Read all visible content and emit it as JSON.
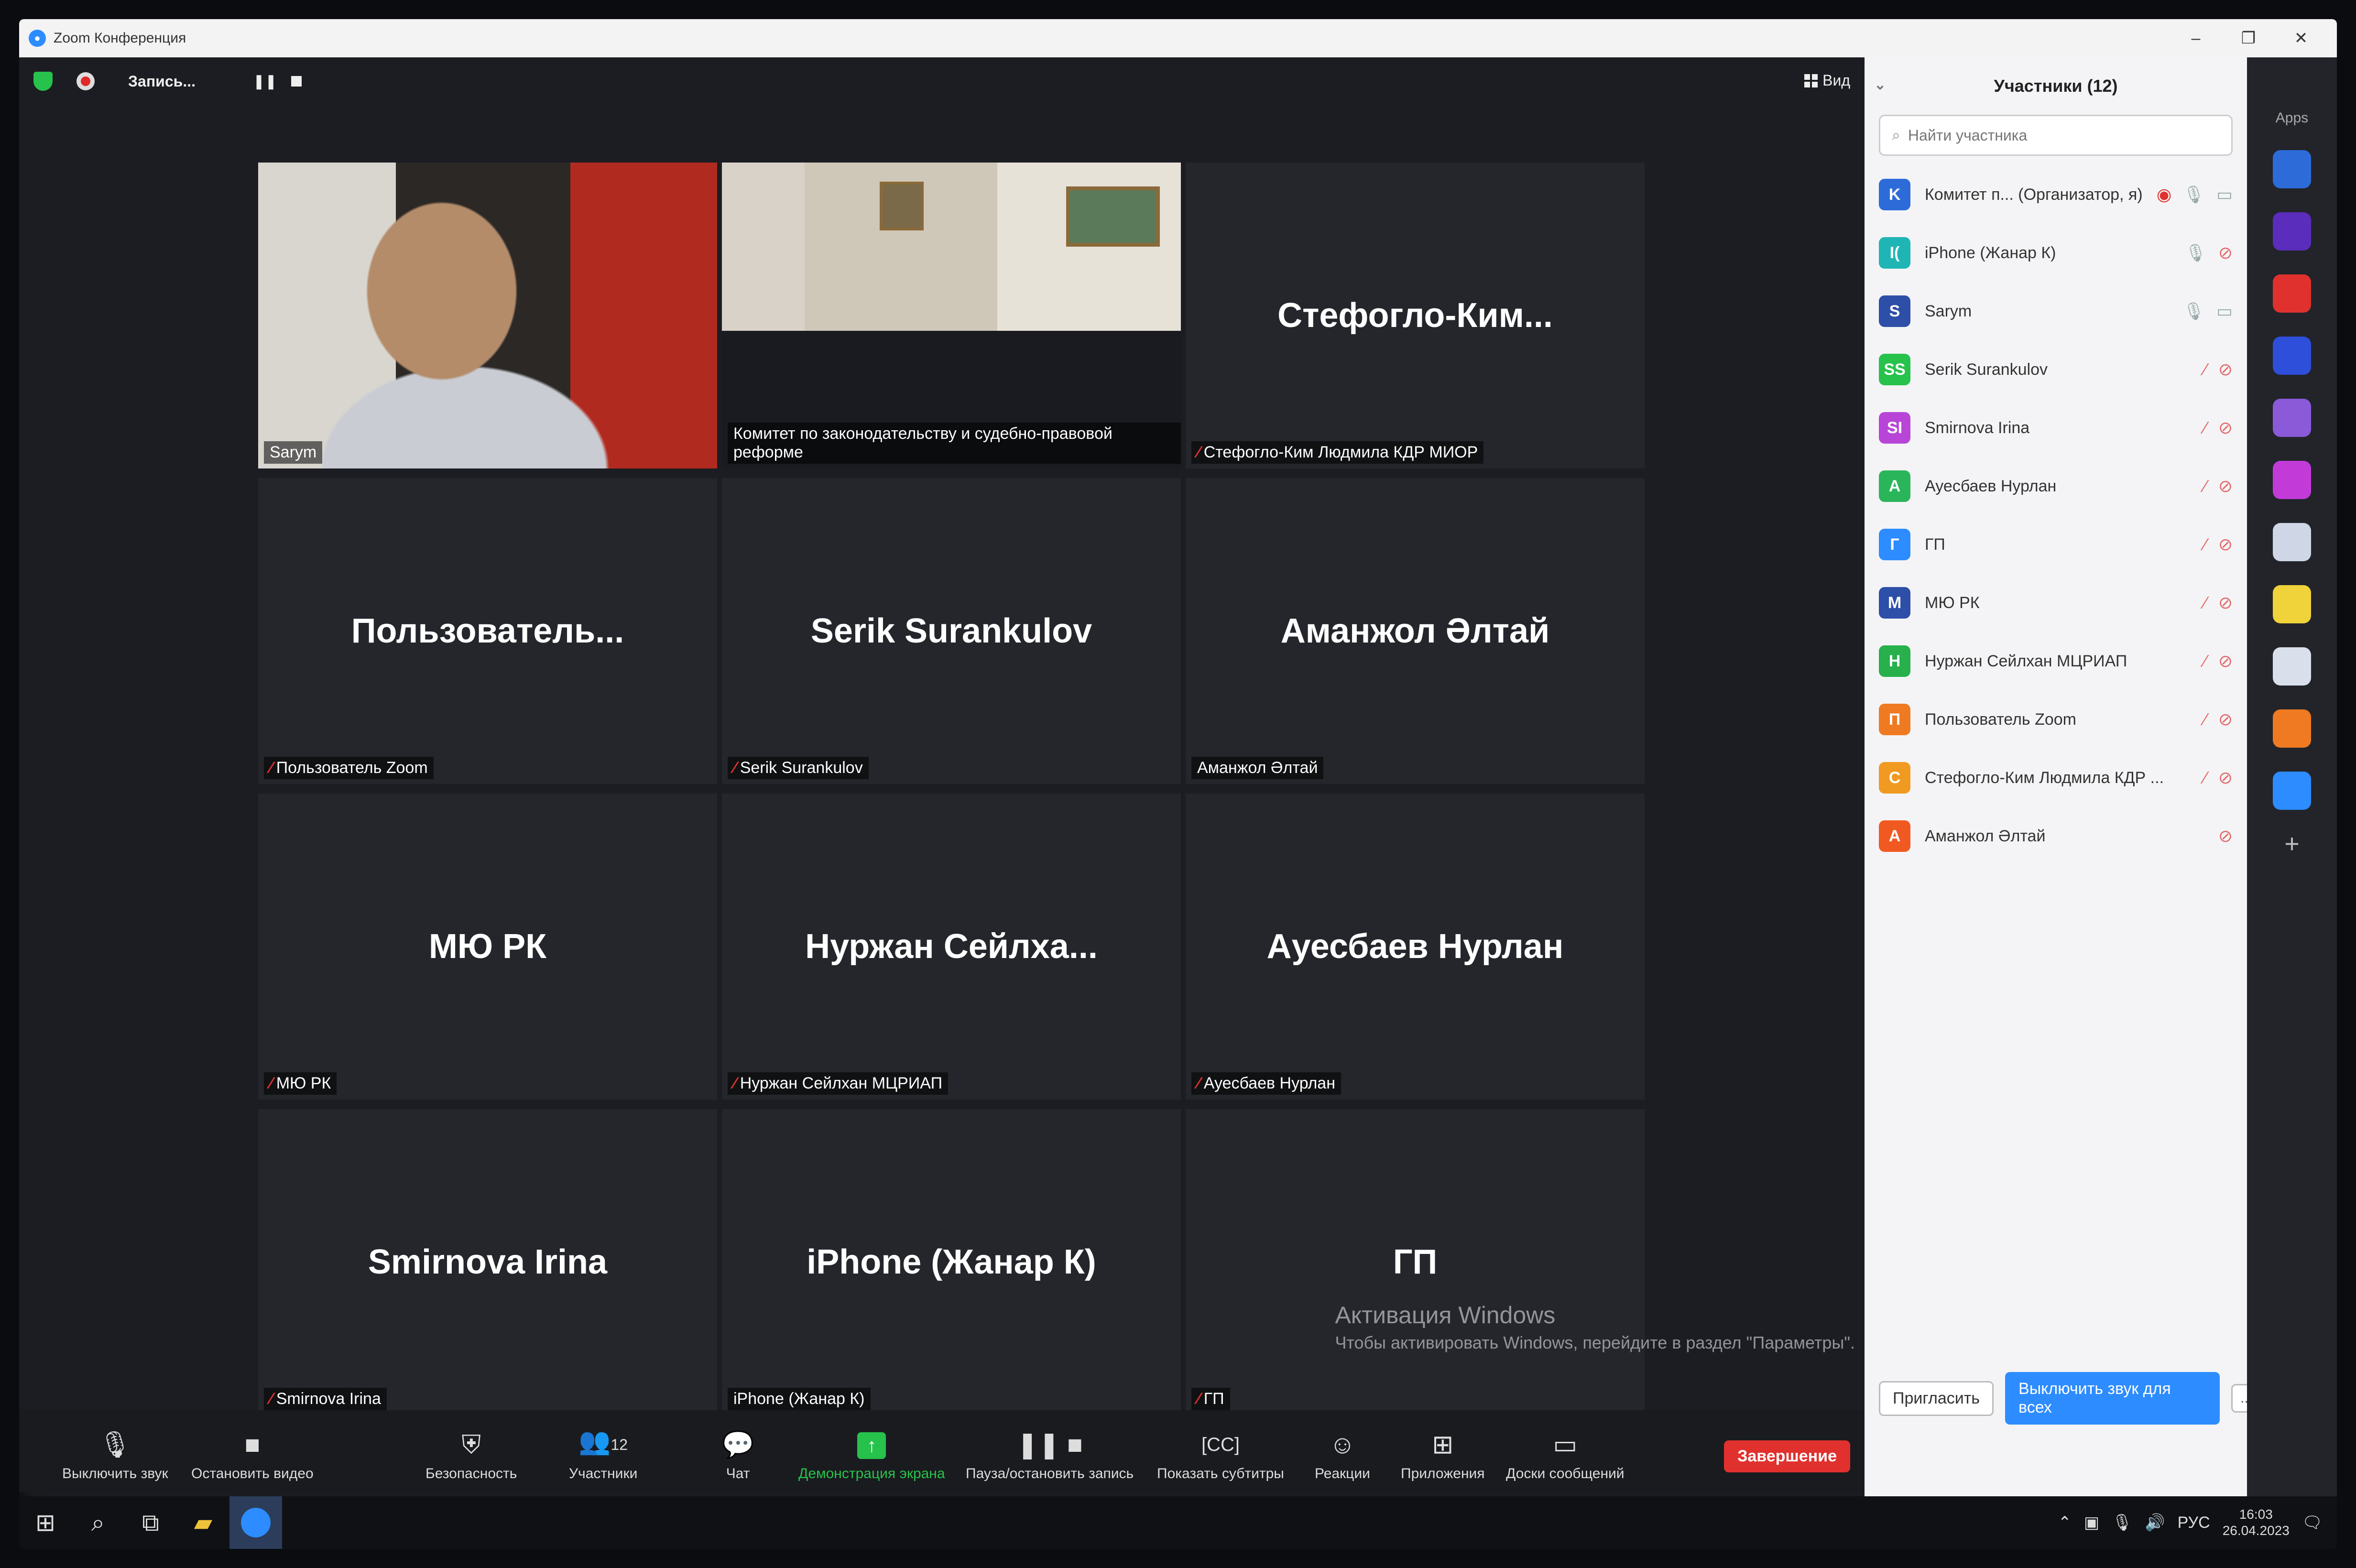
{
  "window": {
    "title": "Zoom Конференция",
    "minimize": "–",
    "restore": "❐",
    "close": "✕"
  },
  "meeting": {
    "recording_label": "Запись...",
    "pause_icon": "❚❚",
    "view_label": "Вид",
    "tiles": [
      {
        "type": "video",
        "caption": "Sarym",
        "muted": false,
        "active": true
      },
      {
        "type": "video",
        "caption": "Комитет по законодательству и судебно-правовой реформе",
        "muted": false,
        "active": false
      },
      {
        "type": "name",
        "display": "Стефогло-Ким...",
        "caption": "Стефогло-Ким Людмила КДР МИОР",
        "muted": true
      },
      {
        "type": "name",
        "display": "Пользователь...",
        "caption": "Пользователь Zoom",
        "muted": true
      },
      {
        "type": "name",
        "display": "Serik Surankulov",
        "caption": "Serik Surankulov",
        "muted": true
      },
      {
        "type": "name",
        "display": "Аманжол Әлтай",
        "caption": "Аманжол Әлтай",
        "muted": false
      },
      {
        "type": "name",
        "display": "МЮ РК",
        "caption": "МЮ РК",
        "muted": true
      },
      {
        "type": "name",
        "display": "Нуржан Сейлха...",
        "caption": "Нуржан Сейлхан МЦРИАП",
        "muted": true
      },
      {
        "type": "name",
        "display": "Ауесбаев Нурлан",
        "caption": "Ауесбаев Нурлан",
        "muted": true
      },
      {
        "type": "name",
        "display": "Smirnova Irina",
        "caption": "Smirnova Irina",
        "muted": true
      },
      {
        "type": "name",
        "display": "iPhone (Жанар К)",
        "caption": "iPhone (Жанар К)",
        "muted": false
      },
      {
        "type": "name",
        "display": "ГП",
        "caption": "ГП",
        "muted": true
      }
    ]
  },
  "toolbar": {
    "mute": "Выключить звук",
    "video": "Остановить видео",
    "security": "Безопасность",
    "participants": "Участники",
    "participants_count": "12",
    "chat": "Чат",
    "share": "Демонстрация экрана",
    "record": "Пауза/остановить запись",
    "captions": "Показать субтитры",
    "reactions": "Реакции",
    "apps": "Приложения",
    "whiteboards": "Доски сообщений",
    "end": "Завершение"
  },
  "watermark": {
    "line1": "Активация Windows",
    "line2": "Чтобы активировать Windows, перейдите в раздел \"Параметры\"."
  },
  "panel": {
    "title": "Участники (12)",
    "search_placeholder": "Найти участника",
    "participants": [
      {
        "initial": "K",
        "name": "Комитет п... (Организатор, я)",
        "color": "#2d6bd9",
        "mic": "on",
        "cam": "on",
        "rec": true
      },
      {
        "initial": "I(",
        "name": "iPhone (Жанар К)",
        "color": "#1fb5b5",
        "mic": "on",
        "cam": "off"
      },
      {
        "initial": "S",
        "name": "Sarym",
        "color": "#2d4fa8",
        "mic": "on",
        "cam": "on"
      },
      {
        "initial": "SS",
        "name": "Serik Surankulov",
        "color": "#27c24c",
        "mic": "off",
        "cam": "off"
      },
      {
        "initial": "SI",
        "name": "Smirnova Irina",
        "color": "#b845d8",
        "mic": "off",
        "cam": "off"
      },
      {
        "initial": "A",
        "name": "Ауесбаев Нурлан",
        "color": "#2bb55a",
        "mic": "off",
        "cam": "off"
      },
      {
        "initial": "Г",
        "name": "ГП",
        "color": "#2d8cff",
        "mic": "off",
        "cam": "off"
      },
      {
        "initial": "М",
        "name": "МЮ РК",
        "color": "#2d4fa8",
        "mic": "off",
        "cam": "off"
      },
      {
        "initial": "Н",
        "name": "Нуржан Сейлхан МЦРИАП",
        "color": "#27b04c",
        "mic": "off",
        "cam": "off"
      },
      {
        "initial": "П",
        "name": "Пользователь Zoom",
        "color": "#f07a22",
        "mic": "off",
        "cam": "off"
      },
      {
        "initial": "С",
        "name": "Стефогло-Ким Людмила КДР ...",
        "color": "#f09a22",
        "mic": "off",
        "cam": "off"
      },
      {
        "initial": "А",
        "name": "Аманжол Әлтай",
        "color": "#f05a22",
        "mic": "none",
        "cam": "off"
      }
    ],
    "invite": "Пригласить",
    "mute_all": "Выключить звук для всех",
    "more": "..."
  },
  "apps": {
    "title": "Apps",
    "tiles": [
      "#2d6bd9",
      "#5a2dbd",
      "#e0312e",
      "#2d4fd9",
      "#8a5ad9",
      "#c23bd9",
      "#cfd6e6",
      "#f0d23a",
      "#d9e0ec",
      "#f07a22",
      "#2d8cff"
    ]
  },
  "taskbar": {
    "lang": "РУС",
    "time": "16:03",
    "date": "26.04.2023"
  }
}
